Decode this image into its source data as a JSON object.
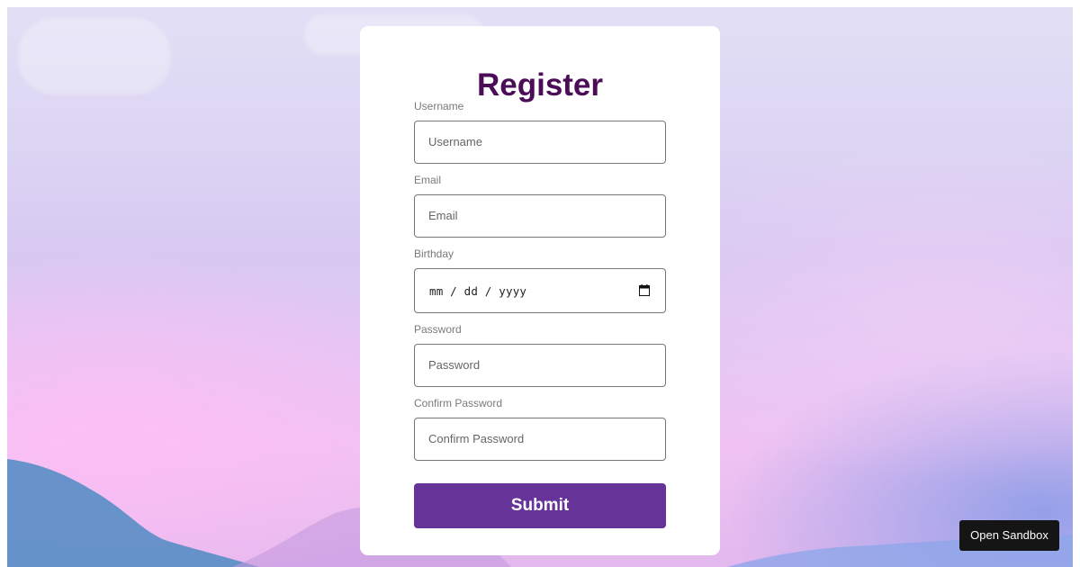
{
  "form": {
    "title": "Register",
    "fields": [
      {
        "label": "Username",
        "placeholder": "Username",
        "type": "text"
      },
      {
        "label": "Email",
        "placeholder": "Email",
        "type": "email"
      },
      {
        "label": "Birthday",
        "placeholder": "mm / dd / yyyy",
        "type": "date"
      },
      {
        "label": "Password",
        "placeholder": "Password",
        "type": "password"
      },
      {
        "label": "Confirm Password",
        "placeholder": "Confirm Password",
        "type": "password"
      }
    ],
    "submit_label": "Submit"
  },
  "sandbox": {
    "open_label": "Open Sandbox"
  },
  "colors": {
    "title": "#4b0d57",
    "submit_bg": "#663399",
    "sandbox_bg": "#151515"
  },
  "icons": {
    "date_picker": "calendar-icon"
  }
}
